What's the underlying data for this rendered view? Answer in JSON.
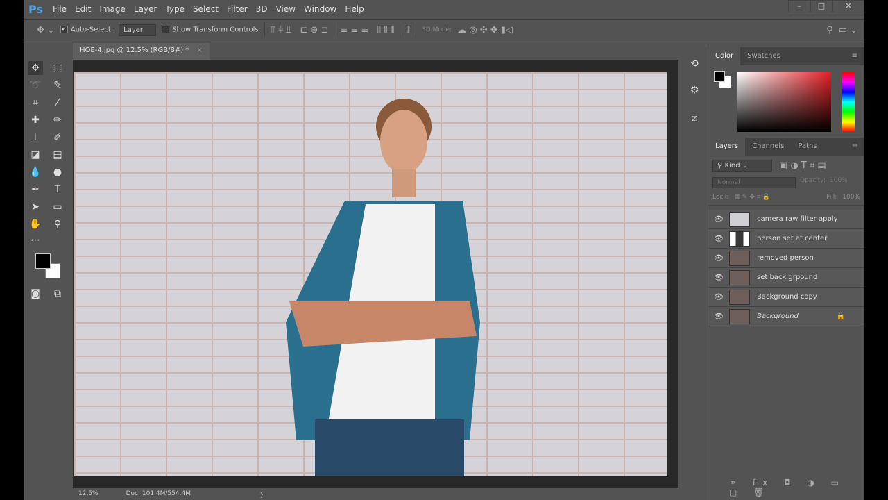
{
  "app": {
    "logo": "Ps",
    "menus": [
      "File",
      "Edit",
      "Image",
      "Layer",
      "Type",
      "Select",
      "Filter",
      "3D",
      "View",
      "Window",
      "Help"
    ],
    "window_buttons": [
      "–",
      "□",
      "✕"
    ]
  },
  "options": {
    "auto_select_label": "Auto-Select:",
    "auto_select_checked": true,
    "layer_select": "Layer",
    "show_transform_label": "Show Transform Controls",
    "mode_3d_label": "3D Mode:"
  },
  "document": {
    "tab_title": "HOE-4.jpg @ 12.5% (RGB/8#) *",
    "close": "×"
  },
  "status": {
    "zoom": "12.5%",
    "doc": "Doc: 101.4M/554.4M",
    "arrow": "〉"
  },
  "color_panel": {
    "tabs": [
      "Color",
      "Swatches"
    ],
    "foreground": "#000000",
    "background": "#ffffff"
  },
  "layers_panel": {
    "tabs": [
      "Layers",
      "Channels",
      "Paths"
    ],
    "filter": "Kind",
    "blend_mode": "Normal",
    "opacity_label": "Opacity:",
    "opacity": "100%",
    "lock_label": "Lock:",
    "fill_label": "Fill:",
    "fill": "100%",
    "layers": [
      {
        "name": "camera raw filter apply"
      },
      {
        "name": "person set at center"
      },
      {
        "name": "removed person"
      },
      {
        "name": "set back grpound"
      },
      {
        "name": "Background copy"
      },
      {
        "name": "Background",
        "locked": true
      }
    ]
  }
}
